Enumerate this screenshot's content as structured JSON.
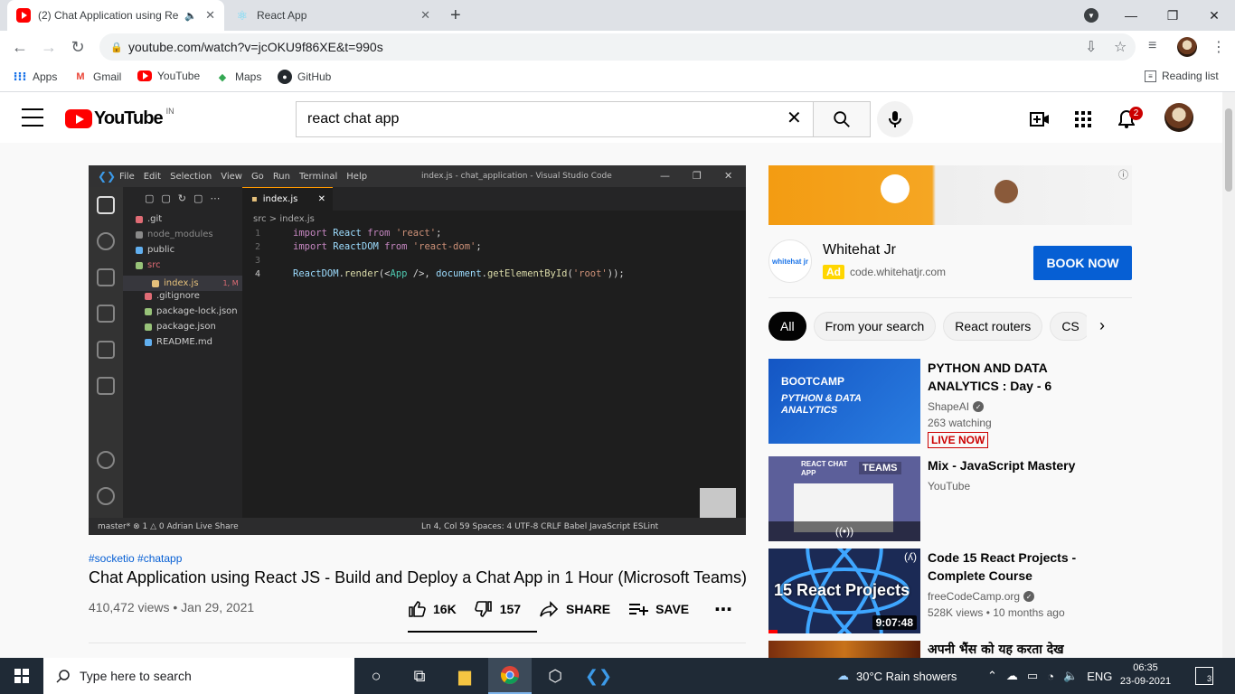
{
  "browser": {
    "tabs": [
      {
        "label": "(2) Chat Application using Re",
        "active": true
      },
      {
        "label": "React App",
        "active": false
      }
    ],
    "new_tab_symbol": "+",
    "url": "youtube.com/watch?v=jcOKU9f86XE&t=990s",
    "bookmarks": [
      "Apps",
      "Gmail",
      "YouTube",
      "Maps",
      "GitHub"
    ],
    "reading_list": "Reading list"
  },
  "youtube": {
    "logo_text": "YouTube",
    "country_code": "IN",
    "search_query": "react chat app",
    "notification_count": "2"
  },
  "video": {
    "hashtags": "#socketio #chatapp",
    "title": "Chat Application using React JS - Build and Deploy a Chat App in 1 Hour (Microsoft Teams)",
    "meta": "410,472 views • Jan 29, 2021",
    "likes": "16K",
    "dislikes": "157",
    "share_label": "SHARE",
    "save_label": "SAVE",
    "progress_fraction_note": "like ratio bar shown under likes"
  },
  "vscode": {
    "menu": [
      "File",
      "Edit",
      "Selection",
      "View",
      "Go",
      "Run",
      "Terminal",
      "Help"
    ],
    "window_title": "index.js - chat_application - Visual Studio Code",
    "files": [
      {
        "name": ".git",
        "color": "#e06c75"
      },
      {
        "name": "node_modules",
        "color": "#8a8a8a"
      },
      {
        "name": "public",
        "color": "#61afef"
      },
      {
        "name": "src",
        "color": "#98c379"
      },
      {
        "name": "index.js",
        "color": "#e5c07b",
        "note": "1, M"
      },
      {
        "name": ".gitignore",
        "color": "#e06c75"
      },
      {
        "name": "package-lock.json",
        "color": "#98c379"
      },
      {
        "name": "package.json",
        "color": "#98c379"
      },
      {
        "name": "README.md",
        "color": "#61afef"
      }
    ],
    "tab": "index.js",
    "breadcrumb": "src  >  index.js",
    "status_left": "master*   ⊗ 1 △ 0    Adrian    Live Share",
    "status_right": "Ln 4, Col 59   Spaces: 4   UTF-8   CRLF   Babel JavaScript   ESLint"
  },
  "ad": {
    "advertiser": "Whitehat Jr",
    "ad_label": "Ad",
    "domain": "code.whitehatjr.com",
    "cta": "BOOK NOW",
    "logo_text": "whitehat jr"
  },
  "chips": [
    "All",
    "From your search",
    "React routers",
    "CS"
  ],
  "recommendations": [
    {
      "title": "PYTHON AND DATA ANALYTICS : Day - 6",
      "channel": "ShapeAI",
      "verified": true,
      "meta": "263 watching",
      "badge": "LIVE NOW",
      "thumb_text_1": "BOOTCAMP",
      "thumb_text_2": "PYTHON & DATA ANALYTICS"
    },
    {
      "title": "Mix - JavaScript Mastery",
      "channel": "YouTube",
      "verified": false,
      "thumb_text_1": "REACT CHAT APP",
      "thumb_text_2": "TEAMS"
    },
    {
      "title": "Code 15 React Projects - Complete Course",
      "channel": "freeCodeCamp.org",
      "verified": true,
      "meta": "528K views • 10 months ago",
      "duration": "9:07:48",
      "thumb_text_1": "15 React Projects"
    },
    {
      "title": "अपनी भैंस को यह करता देख"
    }
  ],
  "taskbar": {
    "search_placeholder": "Type here to search",
    "weather": "30°C  Rain showers",
    "language": "ENG",
    "time": "06:35",
    "date": "23-09-2021",
    "notifications": "3"
  }
}
